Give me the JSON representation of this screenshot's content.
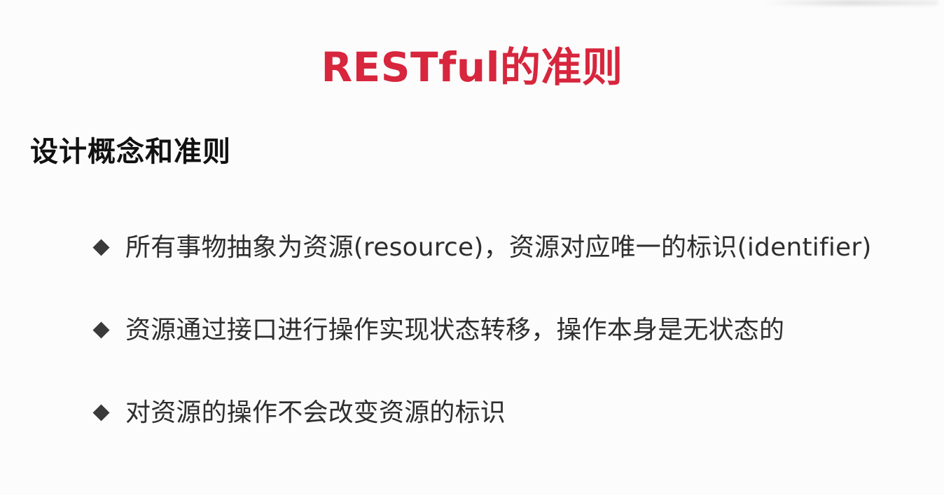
{
  "slide": {
    "title": "RESTful的准则",
    "subtitle": "设计概念和准则",
    "bullets": [
      {
        "text": "所有事物抽象为资源(resource)，资源对应唯一的标识(identifier)"
      },
      {
        "text": "资源通过接口进行操作实现状态转移，操作本身是无状态的"
      },
      {
        "text": "对资源的操作不会改变资源的标识"
      }
    ]
  },
  "colors": {
    "title": "#d7263d",
    "text": "#2f2f2f",
    "bullet_icon": "#3a3a3a",
    "background": "#fcfcfc"
  },
  "icons": {
    "bullet": "diamond-bullet-icon"
  }
}
